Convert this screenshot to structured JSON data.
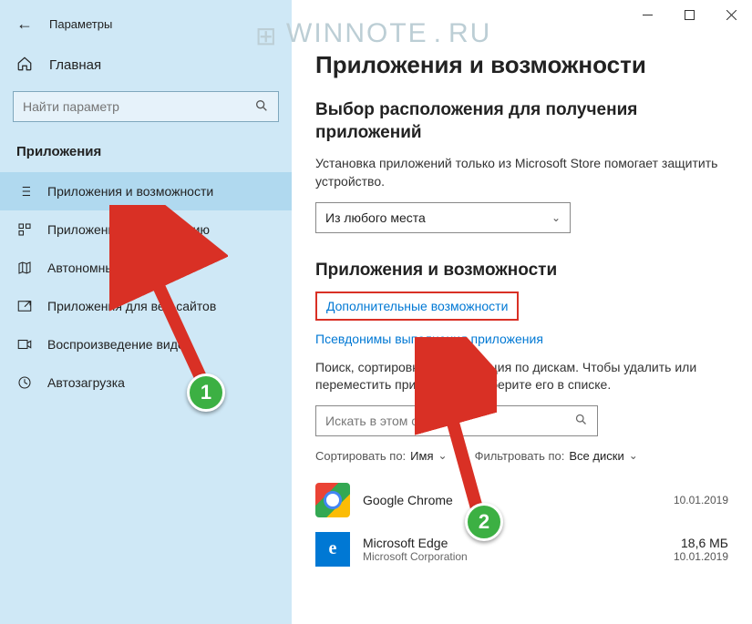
{
  "window": {
    "title": "Параметры"
  },
  "watermark": {
    "text_a": "WINNOTE",
    "text_b": "RU"
  },
  "sidebar": {
    "home": "Главная",
    "search_placeholder": "Найти параметр",
    "section": "Приложения",
    "items": [
      {
        "label": "Приложения и возможности"
      },
      {
        "label": "Приложения по умолчанию"
      },
      {
        "label": "Автономные карты"
      },
      {
        "label": "Приложения для веб-сайтов"
      },
      {
        "label": "Воспроизведение видео"
      },
      {
        "label": "Автозагрузка"
      }
    ]
  },
  "main": {
    "page_title": "Приложения и возможности",
    "section1_title": "Выбор расположения для получения приложений",
    "section1_text": "Установка приложений только из Microsoft Store помогает защитить устройство.",
    "dropdown_value": "Из любого места",
    "section2_title": "Приложения и возможности",
    "link_optional": "Дополнительные возможности",
    "link_aliases": "Псевдонимы выполнения приложения",
    "section2_text": "Поиск, сортировка и фильтрация по дискам. Чтобы удалить или переместить приложение, выберите его в списке.",
    "app_search_placeholder": "Искать в этом списке",
    "sort_label": "Сортировать по:",
    "sort_value": "Имя",
    "filter_label": "Фильтровать по:",
    "filter_value": "Все диски",
    "apps": [
      {
        "name": "Google Chrome",
        "publisher": "",
        "size": "",
        "date": "10.01.2019"
      },
      {
        "name": "Microsoft Edge",
        "publisher": "Microsoft Corporation",
        "size": "18,6 МБ",
        "date": "10.01.2019"
      }
    ]
  },
  "badges": {
    "one": "1",
    "two": "2"
  }
}
